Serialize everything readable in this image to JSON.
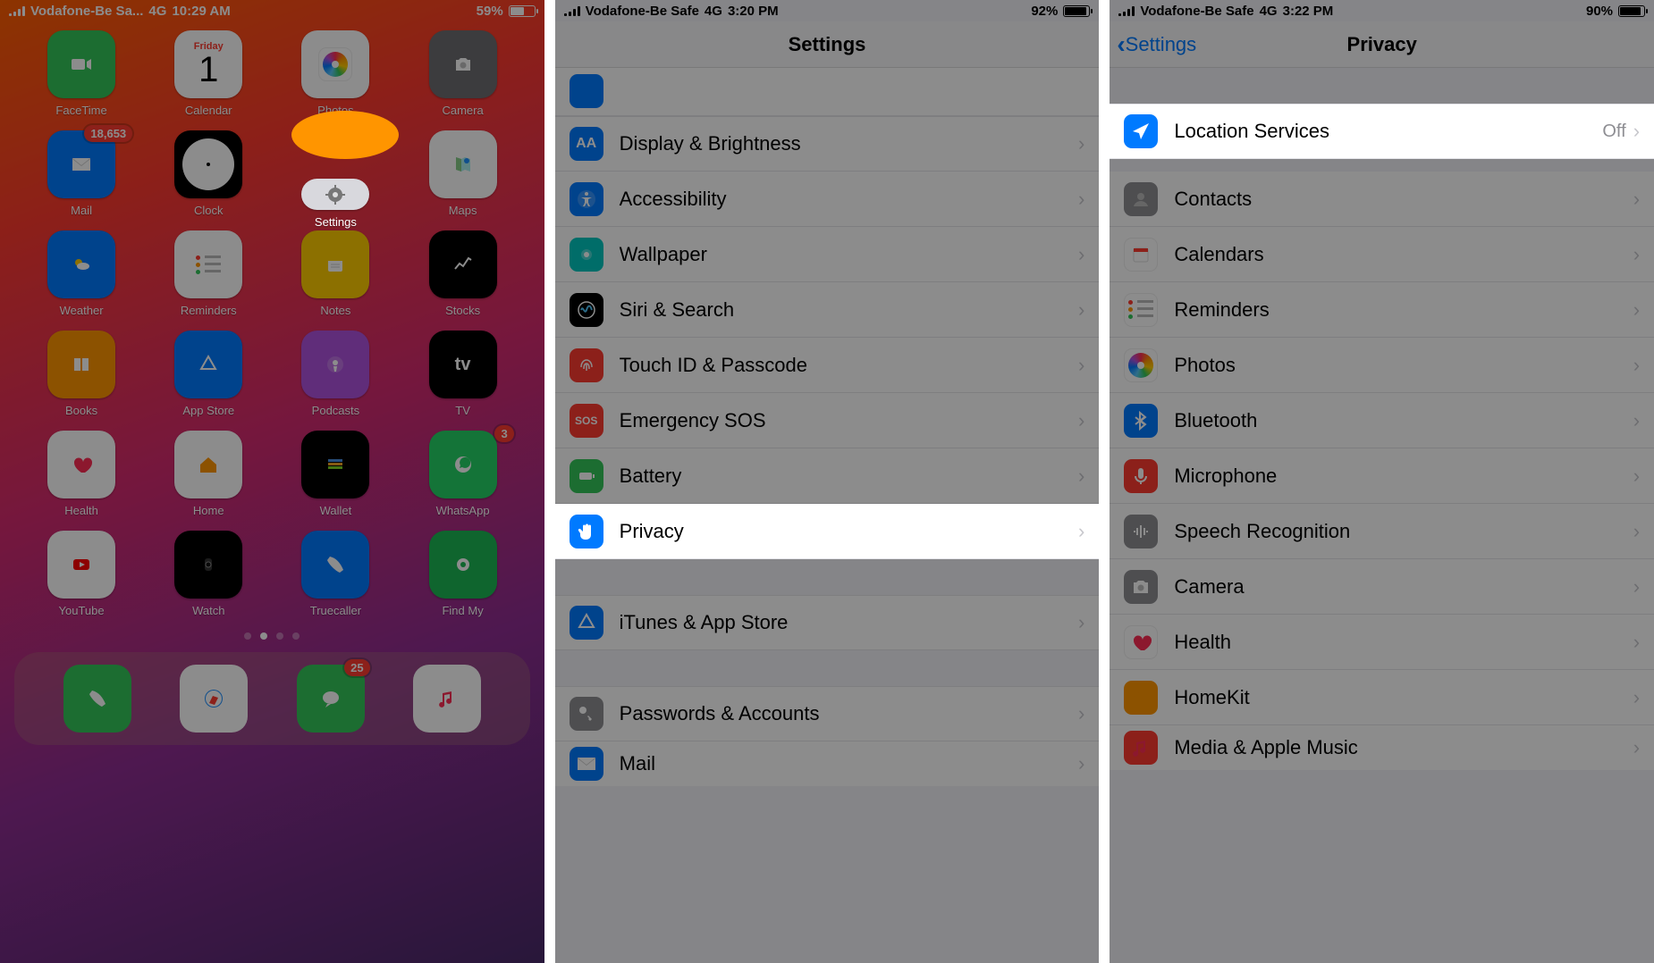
{
  "shot1": {
    "status": {
      "carrier": "Vodafone-Be Sa...",
      "net": "4G",
      "time": "10:29 AM",
      "battery_pct": "59%",
      "battery_fill": 59
    },
    "apps": [
      {
        "slug": "facetime",
        "label": "FaceTime",
        "bg": "bg-green",
        "glyph": "video"
      },
      {
        "slug": "calendar",
        "label": "Calendar",
        "bg": "bg-white",
        "glyph": "calendar",
        "day": "Friday",
        "num": "1"
      },
      {
        "slug": "photos",
        "label": "Photos",
        "bg": "bg-white",
        "glyph": "photos"
      },
      {
        "slug": "camera",
        "label": "Camera",
        "bg": "bg-gray",
        "glyph": "camera"
      },
      {
        "slug": "mail",
        "label": "Mail",
        "bg": "bg-blue",
        "glyph": "mail",
        "badge": "18,653"
      },
      {
        "slug": "clock",
        "label": "Clock",
        "bg": "bg-black",
        "glyph": "clock"
      },
      {
        "slug": "settings",
        "label": "Settings",
        "bg": "bg-lgray",
        "glyph": "gear",
        "highlight": true
      },
      {
        "slug": "maps",
        "label": "Maps",
        "bg": "bg-white",
        "glyph": "maps"
      },
      {
        "slug": "weather",
        "label": "Weather",
        "bg": "bg-blue",
        "glyph": "weather"
      },
      {
        "slug": "reminders",
        "label": "Reminders",
        "bg": "bg-white",
        "glyph": "reminders"
      },
      {
        "slug": "notes",
        "label": "Notes",
        "bg": "bg-yellow",
        "glyph": "notes"
      },
      {
        "slug": "stocks",
        "label": "Stocks",
        "bg": "bg-black",
        "glyph": "stocks"
      },
      {
        "slug": "books",
        "label": "Books",
        "bg": "bg-orange",
        "glyph": "books"
      },
      {
        "slug": "appstore",
        "label": "App Store",
        "bg": "bg-blue",
        "glyph": "appstore"
      },
      {
        "slug": "podcasts",
        "label": "Podcasts",
        "bg": "bg-pink ic-pink",
        "glyph": "podcasts"
      },
      {
        "slug": "tv",
        "label": "TV",
        "bg": "bg-black",
        "glyph": "tv"
      },
      {
        "slug": "health",
        "label": "Health",
        "bg": "bg-white",
        "glyph": "health"
      },
      {
        "slug": "home",
        "label": "Home",
        "bg": "bg-white",
        "glyph": "home"
      },
      {
        "slug": "wallet",
        "label": "Wallet",
        "bg": "bg-black",
        "glyph": "wallet"
      },
      {
        "slug": "whatsapp",
        "label": "WhatsApp",
        "bg": "bg-wa",
        "glyph": "whatsapp",
        "badge": "3"
      },
      {
        "slug": "youtube",
        "label": "YouTube",
        "bg": "bg-white",
        "glyph": "youtube"
      },
      {
        "slug": "watch",
        "label": "Watch",
        "bg": "bg-black",
        "glyph": "watch"
      },
      {
        "slug": "truecaller",
        "label": "Truecaller",
        "bg": "bg-blue",
        "glyph": "truecaller"
      },
      {
        "slug": "findmy",
        "label": "Find My",
        "bg": "bg-green2",
        "glyph": "findmy"
      }
    ],
    "dock": [
      {
        "slug": "phone",
        "bg": "bg-green",
        "glyph": "phone"
      },
      {
        "slug": "safari",
        "bg": "bg-white",
        "glyph": "safari"
      },
      {
        "slug": "messages",
        "bg": "bg-green",
        "glyph": "messages",
        "badge": "25"
      },
      {
        "slug": "music",
        "bg": "bg-white",
        "glyph": "music"
      }
    ],
    "page_dots": {
      "count": 4,
      "active": 1
    }
  },
  "shot2": {
    "status": {
      "carrier": "Vodafone-Be Safe",
      "net": "4G",
      "time": "3:20 PM",
      "battery_pct": "92%",
      "battery_fill": 92
    },
    "title": "Settings",
    "rows": [
      {
        "slug": "display-brightness",
        "label": "Display & Brightness",
        "ic": "ic-blue",
        "glyph": "AA"
      },
      {
        "slug": "accessibility",
        "label": "Accessibility",
        "ic": "ic-blue",
        "glyph": "access"
      },
      {
        "slug": "wallpaper",
        "label": "Wallpaper",
        "ic": "ic-cyan",
        "glyph": "wallpaper"
      },
      {
        "slug": "siri-search",
        "label": "Siri & Search",
        "ic": "ic-black",
        "glyph": "siri"
      },
      {
        "slug": "touchid-passcode",
        "label": "Touch ID & Passcode",
        "ic": "ic-red",
        "glyph": "finger"
      },
      {
        "slug": "emergency-sos",
        "label": "Emergency SOS",
        "ic": "ic-red",
        "glyph": "SOS",
        "text": true
      },
      {
        "slug": "battery",
        "label": "Battery",
        "ic": "ic-green",
        "glyph": "battery"
      },
      {
        "slug": "privacy",
        "label": "Privacy",
        "ic": "ic-blue",
        "glyph": "hand",
        "highlight": true
      }
    ],
    "rows2": [
      {
        "slug": "itunes-appstore",
        "label": "iTunes & App Store",
        "ic": "ic-blue",
        "glyph": "appstore"
      }
    ],
    "rows3": [
      {
        "slug": "passwords-accounts",
        "label": "Passwords & Accounts",
        "ic": "ic-gray",
        "glyph": "key"
      },
      {
        "slug": "mail",
        "label": "Mail",
        "ic": "ic-blue",
        "glyph": "mail",
        "partial": true
      }
    ]
  },
  "shot3": {
    "status": {
      "carrier": "Vodafone-Be Safe",
      "net": "4G",
      "time": "3:22 PM",
      "battery_pct": "90%",
      "battery_fill": 90
    },
    "back": "Settings",
    "title": "Privacy",
    "rows": [
      {
        "slug": "location-services",
        "label": "Location Services",
        "ic": "ic-blue",
        "glyph": "nav",
        "value": "Off",
        "highlight": true
      },
      {
        "slug": "contacts",
        "label": "Contacts",
        "ic": "ic-gray",
        "glyph": "contacts"
      },
      {
        "slug": "calendars",
        "label": "Calendars",
        "ic": "ic-white",
        "glyph": "calendars"
      },
      {
        "slug": "reminders",
        "label": "Reminders",
        "ic": "ic-white",
        "glyph": "reminders"
      },
      {
        "slug": "photos",
        "label": "Photos",
        "ic": "photos",
        "glyph": "photos"
      },
      {
        "slug": "bluetooth",
        "label": "Bluetooth",
        "ic": "ic-blue",
        "glyph": "bt"
      },
      {
        "slug": "microphone",
        "label": "Microphone",
        "ic": "ic-red",
        "glyph": "mic"
      },
      {
        "slug": "speech-recognition",
        "label": "Speech Recognition",
        "ic": "ic-gray",
        "glyph": "wave"
      },
      {
        "slug": "camera",
        "label": "Camera",
        "ic": "ic-gray",
        "glyph": "camera"
      },
      {
        "slug": "health",
        "label": "Health",
        "ic": "ic-white",
        "glyph": "heart"
      },
      {
        "slug": "homekit",
        "label": "HomeKit",
        "ic": "ic-orange",
        "glyph": "home"
      },
      {
        "slug": "media-apple-music",
        "label": "Media & Apple Music",
        "ic": "ic-red",
        "glyph": "music",
        "partial": true
      }
    ]
  }
}
